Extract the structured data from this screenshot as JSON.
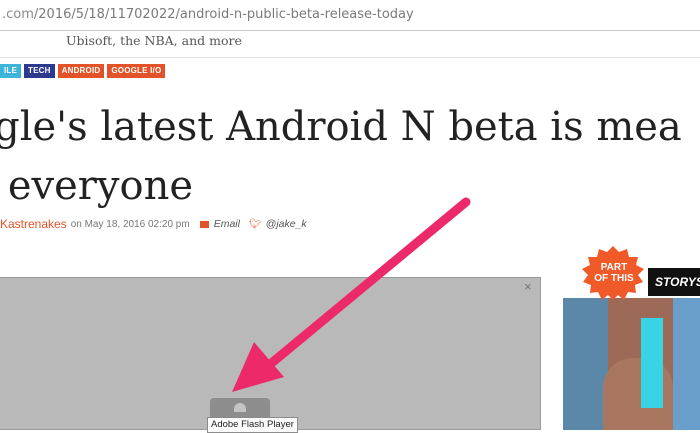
{
  "browser": {
    "url_host": ".com",
    "url_path": "/2016/5/18/11702022/android-n-public-beta-release-today"
  },
  "teaser": {
    "text": "Ubisoft, the NBA, and more"
  },
  "tags": [
    {
      "label": "ILE",
      "color": "#3cb5d8"
    },
    {
      "label": "TECH",
      "color": "#2b3a8f"
    },
    {
      "label": "ANDROID",
      "color": "#e2532a"
    },
    {
      "label": "GOOGLE I/O",
      "color": "#e2532a"
    }
  ],
  "article": {
    "headline_line1": "ogle's latest Android N beta is mea",
    "headline_line2": "r everyone",
    "author": "Kastrenakes",
    "date": "on May 18, 2016 02:20 pm",
    "email_label": "Email",
    "twitter_label": "@jake_k"
  },
  "video": {
    "close_symbol": "×",
    "plugin_tooltip": "Adobe Flash Player"
  },
  "sidebar": {
    "badge_line1": "PART",
    "badge_line2": "OF THIS",
    "storystream_label": "STORYS"
  },
  "colors": {
    "accent": "#e2532a",
    "arrow": "#ec2a6a"
  }
}
